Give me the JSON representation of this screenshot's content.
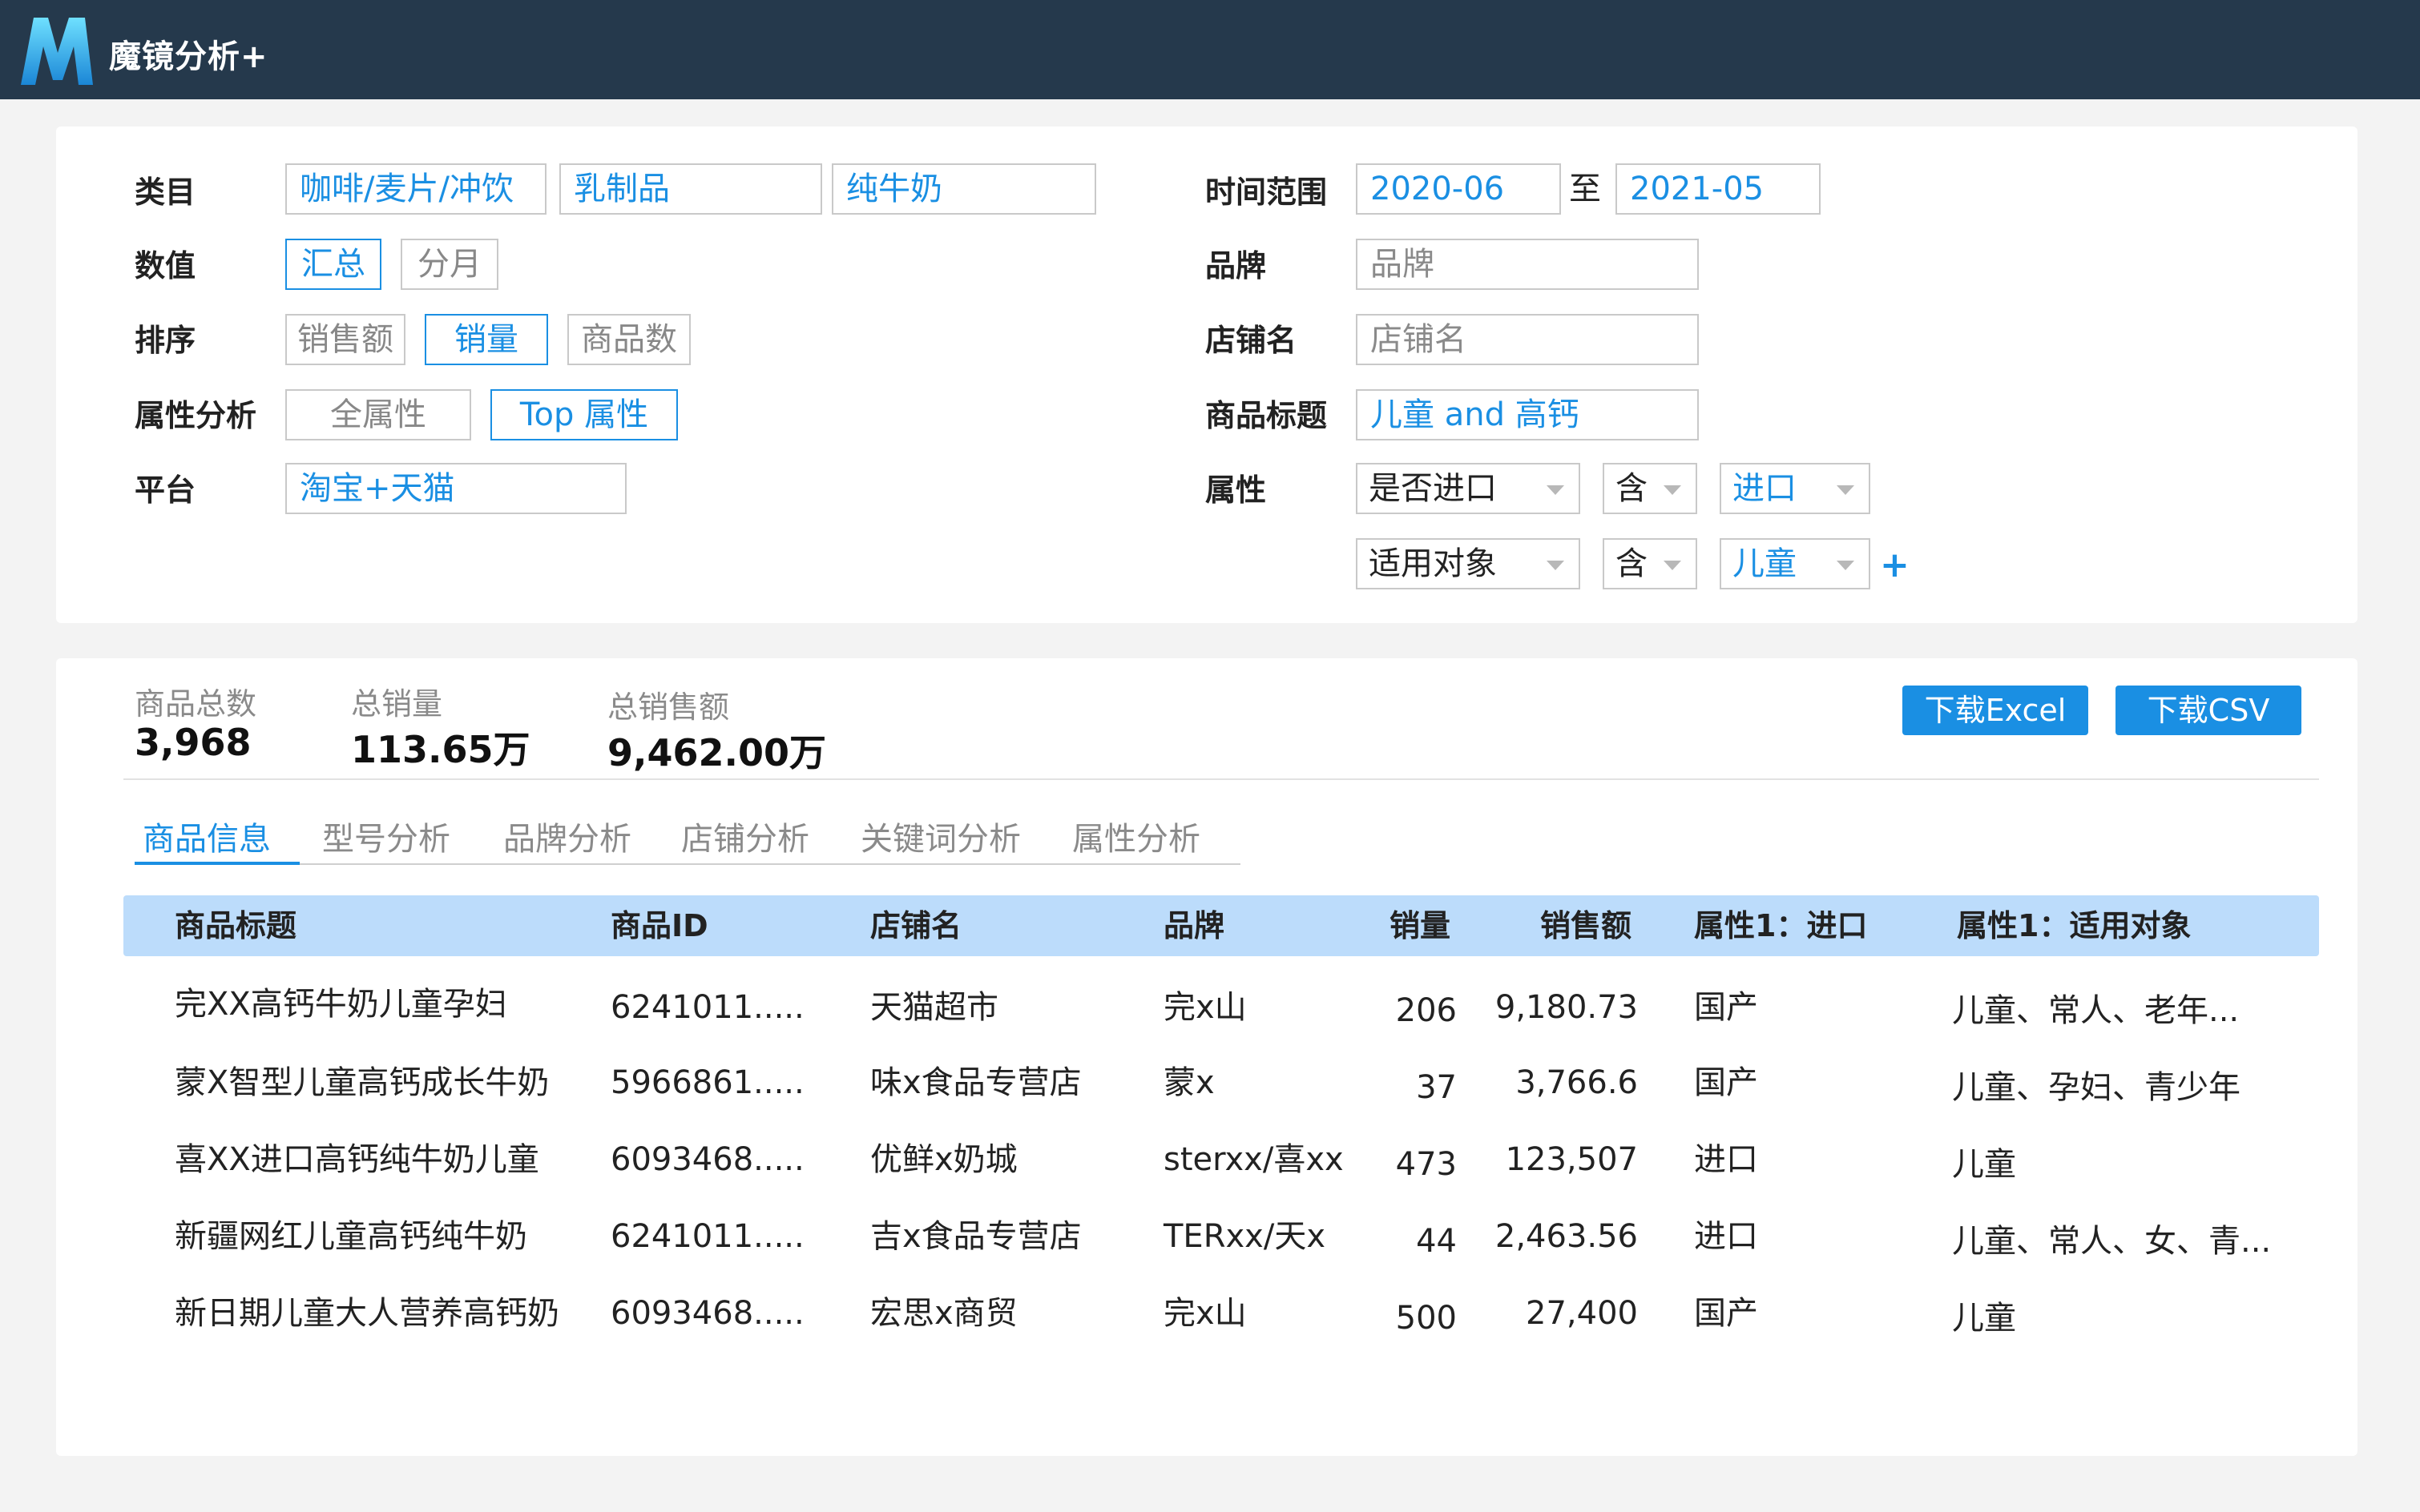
{
  "header": {
    "title": "魔镜分析+"
  },
  "filters": {
    "category_label": "类目",
    "category": [
      "咖啡/麦片/冲饮",
      "乳制品",
      "纯牛奶"
    ],
    "value_label": "数值",
    "value_options": [
      "汇总",
      "分月"
    ],
    "sort_label": "排序",
    "sort_options": [
      "销售额",
      "销量",
      "商品数"
    ],
    "attr_label": "属性分析",
    "attr_options": [
      "全属性",
      "Top 属性"
    ],
    "platform_label": "平台",
    "platform": "淘宝+天猫",
    "time_label": "时间范围",
    "time_from": "2020-06",
    "time_to_sep": "至",
    "time_to": "2021-05",
    "brand_label": "品牌",
    "brand_placeholder": "品牌",
    "shop_label": "店铺名",
    "shop_placeholder": "店铺名",
    "title_label": "商品标题",
    "title_value": "儿童 and 高钙",
    "property_label": "属性",
    "property_rows": [
      {
        "attr": "是否进口",
        "op": "含",
        "value": "进口"
      },
      {
        "attr": "适用对象",
        "op": "含",
        "value": "儿童"
      }
    ],
    "add_symbol": "+"
  },
  "stats": {
    "total_items_label": "商品总数",
    "total_items": "3,968",
    "total_sales_label": "总销量",
    "total_sales": "113.65万",
    "total_revenue_label": "总销售额",
    "total_revenue": "9,462.00万"
  },
  "buttons": {
    "excel": "下载Excel",
    "csv": "下载CSV"
  },
  "tabs": [
    "商品信息",
    "型号分析",
    "品牌分析",
    "店铺分析",
    "关键词分析",
    "属性分析"
  ],
  "table": {
    "columns": [
      "商品标题",
      "商品ID",
      "店铺名",
      "品牌",
      "销量",
      "销售额",
      "属性1：进口",
      "属性1：适用对象"
    ],
    "rows": [
      [
        "完XX高钙牛奶儿童孕妇",
        "6241011.....",
        "天猫超市",
        "完x山",
        "206",
        "9,180.73",
        "国产",
        "儿童、常人、老年..."
      ],
      [
        "蒙X智型儿童高钙成长牛奶",
        "5966861.....",
        "味x食品专营店",
        "蒙x",
        "37",
        "3,766.6",
        "国产",
        "儿童、孕妇、青少年"
      ],
      [
        "喜XX进口高钙纯牛奶儿童",
        "6093468.....",
        "优鲜x奶城",
        "sterxx/喜xx",
        "473",
        "123,507",
        "进口",
        "儿童"
      ],
      [
        "新疆网红儿童高钙纯牛奶",
        "6241011.....",
        "吉x食品专营店",
        "TERxx/天x",
        "44",
        "2,463.56",
        "进口",
        "儿童、常人、女、青..."
      ],
      [
        "新日期儿童大人营养高钙奶",
        "6093468.....",
        "宏思x商贸",
        "完x山",
        "500",
        "27,400",
        "国产",
        "儿童"
      ]
    ]
  }
}
